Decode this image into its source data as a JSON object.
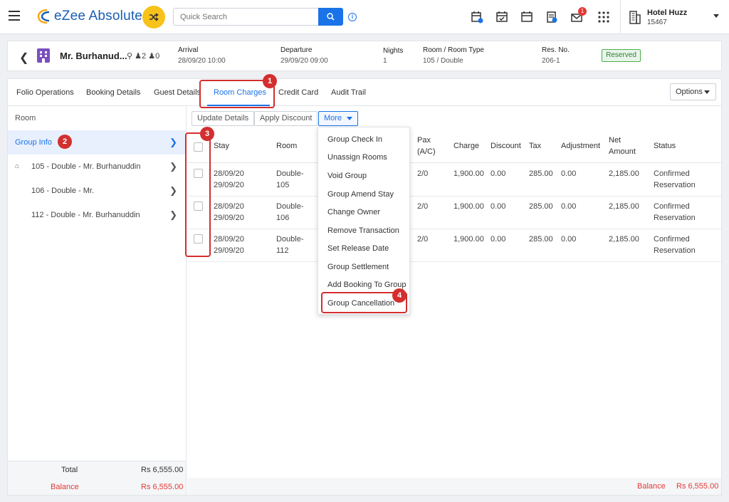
{
  "app": {
    "brand": "eZee Absolute",
    "search_placeholder": "Quick Search",
    "mail_badge": "1",
    "hotel_name": "Hotel Huzz",
    "hotel_id": "15467"
  },
  "guest": {
    "name": "Mr. Burhanud...",
    "adults": "2",
    "children": "0",
    "arrival_label": "Arrival",
    "arrival_value": "28/09/20 10:00",
    "departure_label": "Departure",
    "departure_value": "29/09/20 09:00",
    "nights_label": "Nights",
    "nights_value": "1",
    "room_label": "Room / Room Type",
    "room_value": "105 / Double",
    "resno_label": "Res. No.",
    "resno_value": "206-1",
    "status": "Reserved"
  },
  "tabs": [
    "Folio Operations",
    "Booking Details",
    "Guest Details",
    "Room Charges",
    "Credit Card",
    "Audit Trail"
  ],
  "options_label": "Options",
  "left": {
    "header": "Room",
    "items": [
      {
        "label": "Group Info"
      },
      {
        "label": "105 - Double - Mr. Burhanuddin"
      },
      {
        "label": "106 - Double - Mr."
      },
      {
        "label": "112 - Double - Mr. Burhanuddin"
      }
    ],
    "total_label": "Total",
    "total_value": "Rs 6,555.00",
    "balance_label": "Balance",
    "balance_value": "Rs 6,555.00"
  },
  "toolbar": {
    "update": "Update Details",
    "discount": "Apply Discount",
    "more": "More"
  },
  "table": {
    "headers": [
      "Stay",
      "Room",
      "Pax",
      "(A/C)",
      "Charge",
      "Discount",
      "Tax",
      "Adjustment",
      "Net",
      "Amount",
      "Status"
    ],
    "rows": [
      {
        "stay1": "28/09/20",
        "stay2": "29/09/20",
        "room1": "Double-",
        "room2": "105",
        "pax": "2/0",
        "charge": "1,900.00",
        "discount": "0.00",
        "tax": "285.00",
        "adj": "0.00",
        "net": "2,185.00",
        "status1": "Confirmed",
        "status2": "Reservation"
      },
      {
        "stay1": "28/09/20",
        "stay2": "29/09/20",
        "room1": "Double-",
        "room2": "106",
        "pax": "2/0",
        "charge": "1,900.00",
        "discount": "0.00",
        "tax": "285.00",
        "adj": "0.00",
        "net": "2,185.00",
        "status1": "Confirmed",
        "status2": "Reservation"
      },
      {
        "stay1": "28/09/20",
        "stay2": "29/09/20",
        "room1": "Double-",
        "room2": "112",
        "pax": "2/0",
        "charge": "1,900.00",
        "discount": "0.00",
        "tax": "285.00",
        "adj": "0.00",
        "net": "2,185.00",
        "status1": "Confirmed",
        "status2": "Reservation"
      }
    ],
    "balance_label": "Balance",
    "balance_value": "Rs 6,555.00"
  },
  "menu": [
    "Group Check In",
    "Unassign Rooms",
    "Void Group",
    "Group Amend Stay",
    "Change Owner",
    "Remove Transaction",
    "Set Release Date",
    "Group Settlement",
    "Add Booking To Group",
    "Group Cancellation"
  ],
  "annotations": [
    "1",
    "2",
    "3",
    "4"
  ],
  "colors": {
    "accent": "#1a73e8",
    "annotation": "#d32f2f",
    "logo_yellow": "#f7c21a",
    "reserved": "#4caf50"
  }
}
